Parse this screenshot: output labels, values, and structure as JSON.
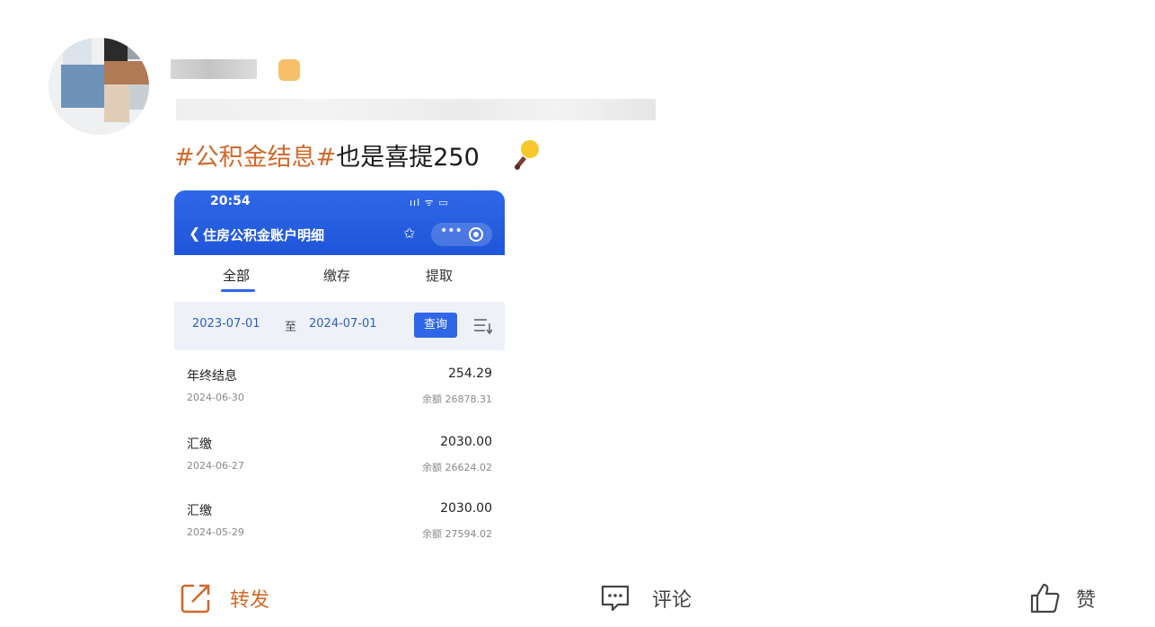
{
  "post": {
    "topic": "#公积金结息#",
    "text": "也是喜提250",
    "emoji_icon": "lightbulb-icon"
  },
  "screenshot": {
    "status_time": "20:54",
    "status_icons": "ııl ᯤ ▭",
    "title": "住房公积金账户明细",
    "back_glyph": "❮",
    "star_glyph": "✩",
    "more_glyph": "•••",
    "tabs": [
      "全部",
      "缴存",
      "提取"
    ],
    "active_tab": 0,
    "filter": {
      "from": "2023-07-01",
      "to_word": "至",
      "to": "2024-07-01",
      "query_label": "查询"
    },
    "records": [
      {
        "type": "年终结息",
        "amount": "254.29",
        "date": "2024-06-30",
        "balance_label": "余额",
        "balance": "26878.31"
      },
      {
        "type": "汇缴",
        "amount": "2030.00",
        "date": "2024-06-27",
        "balance_label": "余额",
        "balance": "26624.02"
      },
      {
        "type": "汇缴",
        "amount": "2030.00",
        "date": "2024-05-29",
        "balance_label": "余额",
        "balance": "27594.02"
      }
    ],
    "accent_color": "#2f67e8"
  },
  "actions": {
    "forward": "转发",
    "comment": "评论",
    "like": "赞"
  },
  "colors": {
    "topic": "#d0692a",
    "forward": "#d0692a"
  }
}
